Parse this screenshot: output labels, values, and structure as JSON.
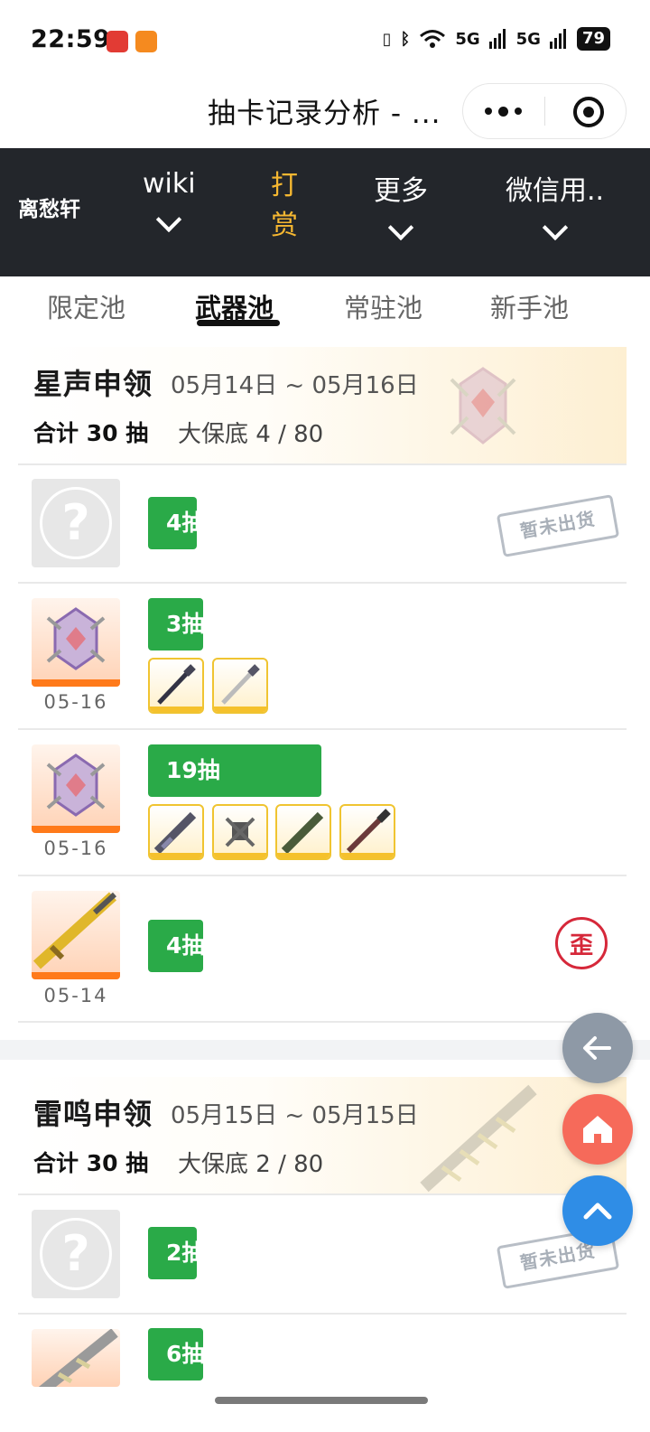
{
  "status_bar": {
    "time": "22:59",
    "network_1": "5G",
    "network_2": "5G",
    "battery": "79",
    "app_icon_1_color": "#e23b34",
    "app_icon_2_color": "#f58a1f"
  },
  "app_header": {
    "title": "抽卡记录分析 - ...",
    "more_icon": "more-dots-icon",
    "close_icon": "target-circle-icon"
  },
  "site_nav": {
    "brand": "离愁轩",
    "items": [
      {
        "label": "wiki",
        "has_dropdown": true
      },
      {
        "label": "打赏",
        "line1": "打",
        "line2": "赏",
        "accent": "#f5b731"
      },
      {
        "label": "更多",
        "has_dropdown": true
      },
      {
        "label": "微信用..",
        "has_dropdown": true
      }
    ]
  },
  "tabs": {
    "items": [
      "限定池",
      "武器池",
      "常驻池",
      "新手池"
    ],
    "active": "武器池"
  },
  "pools": [
    {
      "name": "星声申领",
      "dates": "05月14日 ~ 05月16日",
      "total": "合计 30 抽",
      "pity": "大保底 4 / 80",
      "records": [
        {
          "type": "unknown",
          "pulls": "4抽",
          "status": "暂未出货"
        },
        {
          "type": "obtained",
          "date": "05-16",
          "pulls": "3抽",
          "items": 2
        },
        {
          "type": "obtained",
          "date": "05-16",
          "pulls": "19抽",
          "items": 4
        },
        {
          "type": "obtained",
          "date": "05-14",
          "pulls": "4抽",
          "tag": "歪"
        }
      ]
    },
    {
      "name": "雷鸣申领",
      "dates": "05月15日 ~ 05月15日",
      "total": "合计 30 抽",
      "pity": "大保底 2 / 80",
      "records": [
        {
          "type": "unknown",
          "pulls": "2抽",
          "status": "暂未出货"
        },
        {
          "type": "obtained",
          "pulls": "6抽"
        }
      ]
    }
  ],
  "floating_buttons": {
    "back_icon": "arrow-left-icon",
    "home_icon": "home-icon",
    "top_icon": "chevron-up-icon"
  }
}
